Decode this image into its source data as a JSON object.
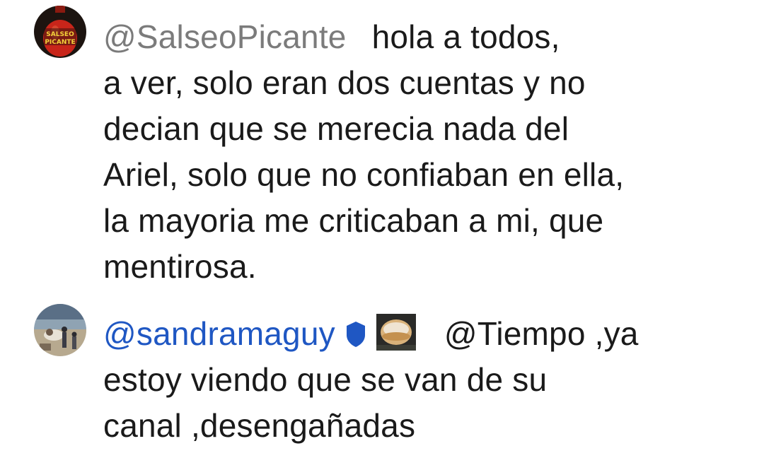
{
  "comments": [
    {
      "avatar_icon": "salseo-picante-bottle-avatar",
      "avatar_text": "SALSEO PICANTE",
      "handle": "@SalseoPicante",
      "lines": [
        "hola a todos,",
        "a ver, solo eran dos cuentas y no",
        "decian que se merecia nada del",
        "Ariel, solo que no confiaban en ella,",
        "la mayoria me criticaban a mi, que",
        "mentirosa."
      ]
    },
    {
      "avatar_icon": "beach-people-avatar",
      "handle": "@sandramaguy",
      "badge_icon": "blue-shield-icon",
      "badge_color": "#1f57c3",
      "inline_image_icon": "pastry-photo-icon",
      "lines": [
        "@Tiempo ,ya",
        "estoy viendo que se van de su",
        "canal ,desengañadas"
      ]
    }
  ]
}
